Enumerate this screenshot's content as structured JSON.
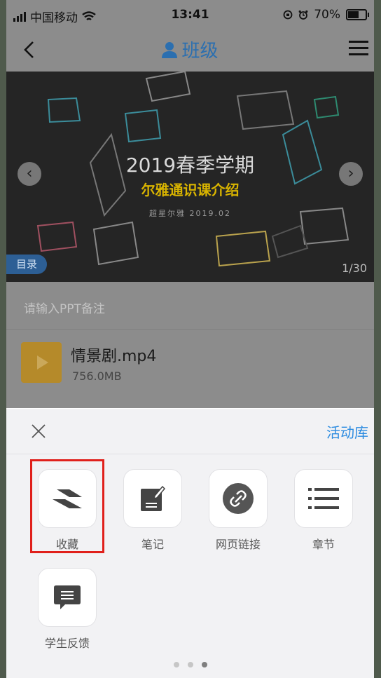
{
  "status_bar": {
    "carrier": "中国移动",
    "time": "13:41",
    "battery": "70%",
    "battery_level": 0.7
  },
  "header": {
    "title": "班级",
    "back_icon": "chevron-left-icon",
    "menu_icon": "hamburger-menu-icon"
  },
  "slide": {
    "title": "2019春季学期",
    "subtitle": "尔雅通识课介绍",
    "caption": "超星尔雅 2019.02",
    "toc_label": "目录",
    "page_indicator": "1/30"
  },
  "notes": {
    "placeholder": "请输入PPT备注"
  },
  "file": {
    "name": "情景剧.mp4",
    "size": "756.0MB",
    "icon": "play-icon"
  },
  "sheet": {
    "activity_library": "活动库",
    "items": [
      {
        "label": "收藏",
        "icon": "collect-icon"
      },
      {
        "label": "笔记",
        "icon": "note-icon"
      },
      {
        "label": "网页链接",
        "icon": "link-icon"
      },
      {
        "label": "章节",
        "icon": "list-icon"
      },
      {
        "label": "学生反馈",
        "icon": "feedback-icon"
      }
    ],
    "page_dots": 3,
    "active_dot": 3
  },
  "colors": {
    "accent": "#2b8be0",
    "highlight": "#e0201b",
    "title_blue": "#2b6fb0"
  }
}
